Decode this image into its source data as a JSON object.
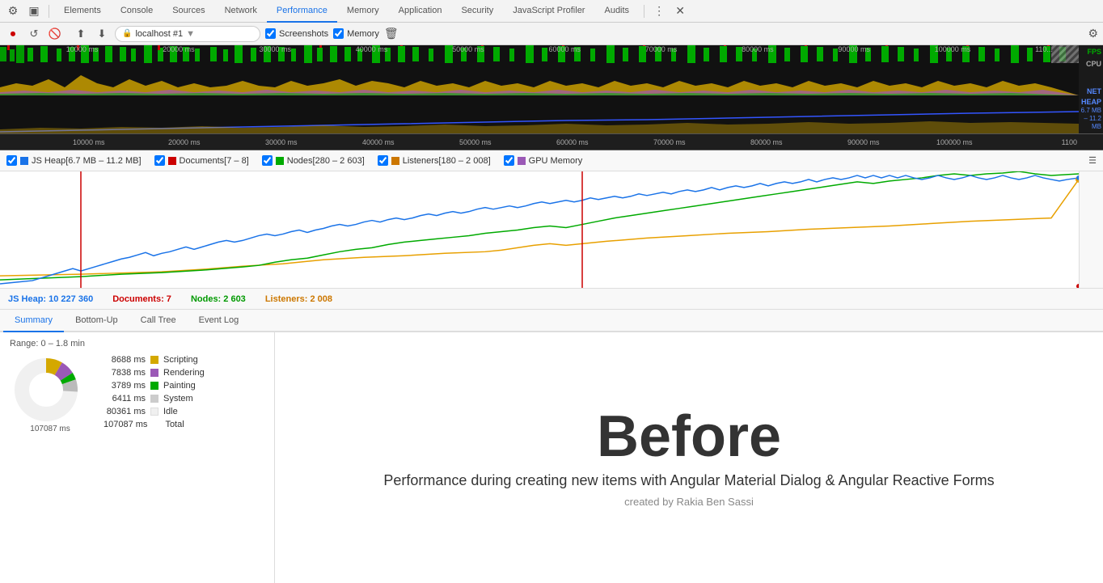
{
  "tabs": {
    "items": [
      {
        "label": "Elements",
        "active": false
      },
      {
        "label": "Console",
        "active": false
      },
      {
        "label": "Sources",
        "active": false
      },
      {
        "label": "Network",
        "active": false
      },
      {
        "label": "Performance",
        "active": true
      },
      {
        "label": "Memory",
        "active": false
      },
      {
        "label": "Application",
        "active": false
      },
      {
        "label": "Security",
        "active": false
      },
      {
        "label": "JavaScript Profiler",
        "active": false
      },
      {
        "label": "Audits",
        "active": false
      }
    ]
  },
  "toolbar": {
    "url": "localhost #1",
    "screenshots_label": "Screenshots",
    "memory_label": "Memory"
  },
  "timeline": {
    "labels": [
      "10000 ms",
      "20000 ms",
      "30000 ms",
      "40000 ms",
      "50000 ms",
      "60000 ms",
      "70000 ms",
      "80000 ms",
      "90000 ms",
      "100000 ms",
      "110..."
    ],
    "fps_label": "FPS",
    "cpu_label": "CPU",
    "net_label": "NET",
    "heap_label": "HEAP",
    "heap_range": "6.7 MB – 11.2 MB",
    "last_label": "1100"
  },
  "ruler": {
    "labels": [
      "10000 ms",
      "20000 ms",
      "30000 ms",
      "40000 ms",
      "50000 ms",
      "60000 ms",
      "70000 ms",
      "80000 ms",
      "90000 ms",
      "100000 ms"
    ]
  },
  "legend": {
    "items": [
      {
        "label": "JS Heap[6.7 MB – 11.2 MB]",
        "color": "#1a73e8",
        "checked": true
      },
      {
        "label": "Documents[7 – 8]",
        "color": "#c00",
        "checked": true
      },
      {
        "label": "Nodes[280 – 2 603]",
        "color": "#0a0",
        "checked": true
      },
      {
        "label": "Listeners[180 – 2 008]",
        "color": "#c70",
        "checked": true
      },
      {
        "label": "GPU Memory",
        "color": "#9b59b6",
        "checked": true
      }
    ]
  },
  "status": {
    "js_heap": "JS Heap: 10 227 360",
    "documents": "Documents: 7",
    "nodes": "Nodes: 2 603",
    "listeners": "Listeners: 2 008"
  },
  "bottom_tabs": [
    {
      "label": "Summary",
      "active": true
    },
    {
      "label": "Bottom-Up",
      "active": false
    },
    {
      "label": "Call Tree",
      "active": false
    },
    {
      "label": "Event Log",
      "active": false
    }
  ],
  "summary": {
    "range": "Range: 0 – 1.8 min",
    "total_ms": "107087 ms",
    "rows": [
      {
        "time": "8688 ms",
        "color": "#d4a800",
        "label": "Scripting"
      },
      {
        "time": "7838 ms",
        "color": "#9b59b6",
        "label": "Rendering"
      },
      {
        "time": "3789 ms",
        "color": "#0a0",
        "label": "Painting"
      },
      {
        "time": "6411 ms",
        "color": "#ccc",
        "label": "System"
      },
      {
        "time": "80361 ms",
        "color": "#f0f0f0",
        "label": "Idle"
      },
      {
        "time": "107087 ms",
        "color": null,
        "label": "Total"
      }
    ]
  },
  "main": {
    "before_text": "Before",
    "description": "Performance during creating new items with Angular Material Dialog & Angular Reactive Forms",
    "credit": "created by Rakia Ben Sassi"
  }
}
